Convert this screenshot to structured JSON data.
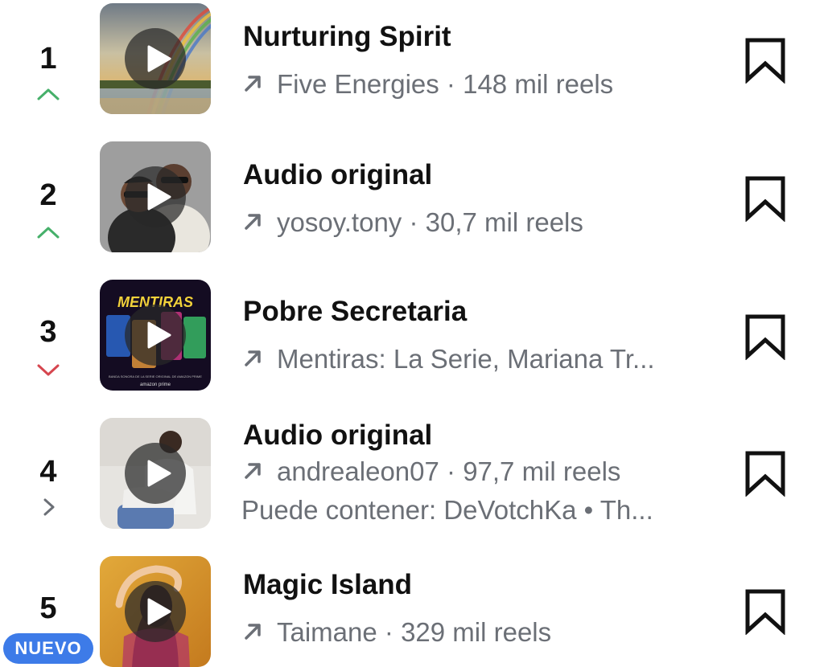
{
  "colors": {
    "trend_up": "#46b06a",
    "trend_down": "#d6464f",
    "trend_same": "#6b6f76",
    "new_badge": "#3d7be8",
    "secondary_text": "#6b6f76"
  },
  "items": [
    {
      "rank": "1",
      "trend": "up",
      "title": "Nurturing Spirit",
      "artist": "Five Energies",
      "separator": " · ",
      "reels": "148 mil reels",
      "icon": "play-icon",
      "action_icon": "bookmark-icon"
    },
    {
      "rank": "2",
      "trend": "up",
      "title": "Audio original",
      "artist": "yosoy.tony",
      "separator": " · ",
      "reels": "30,7 mil reels",
      "icon": "play-icon",
      "action_icon": "bookmark-icon"
    },
    {
      "rank": "3",
      "trend": "down",
      "title": "Pobre Secretaria",
      "artist": "Mentiras: La Serie, Mariana Tr...",
      "thumb_text": "MENTIRAS",
      "thumb_caption": "BANDA SONORA DE LA SERIE ORIGINAL DE AMAZON PRIME",
      "thumb_brand": "amazon prime",
      "icon": "play-icon",
      "action_icon": "bookmark-icon"
    },
    {
      "rank": "4",
      "trend": "same",
      "title": "Audio original",
      "artist": "andrealeon07",
      "separator": " · ",
      "reels": "97,7 mil reels",
      "note": "Puede contener: DeVotchKa • Th...",
      "icon": "play-icon",
      "action_icon": "bookmark-icon"
    },
    {
      "rank": "5",
      "trend": "new",
      "badge": "NUEVO",
      "title": "Magic Island",
      "artist": "Taimane",
      "separator": " · ",
      "reels": "329 mil reels",
      "icon": "play-icon",
      "action_icon": "bookmark-icon"
    }
  ]
}
